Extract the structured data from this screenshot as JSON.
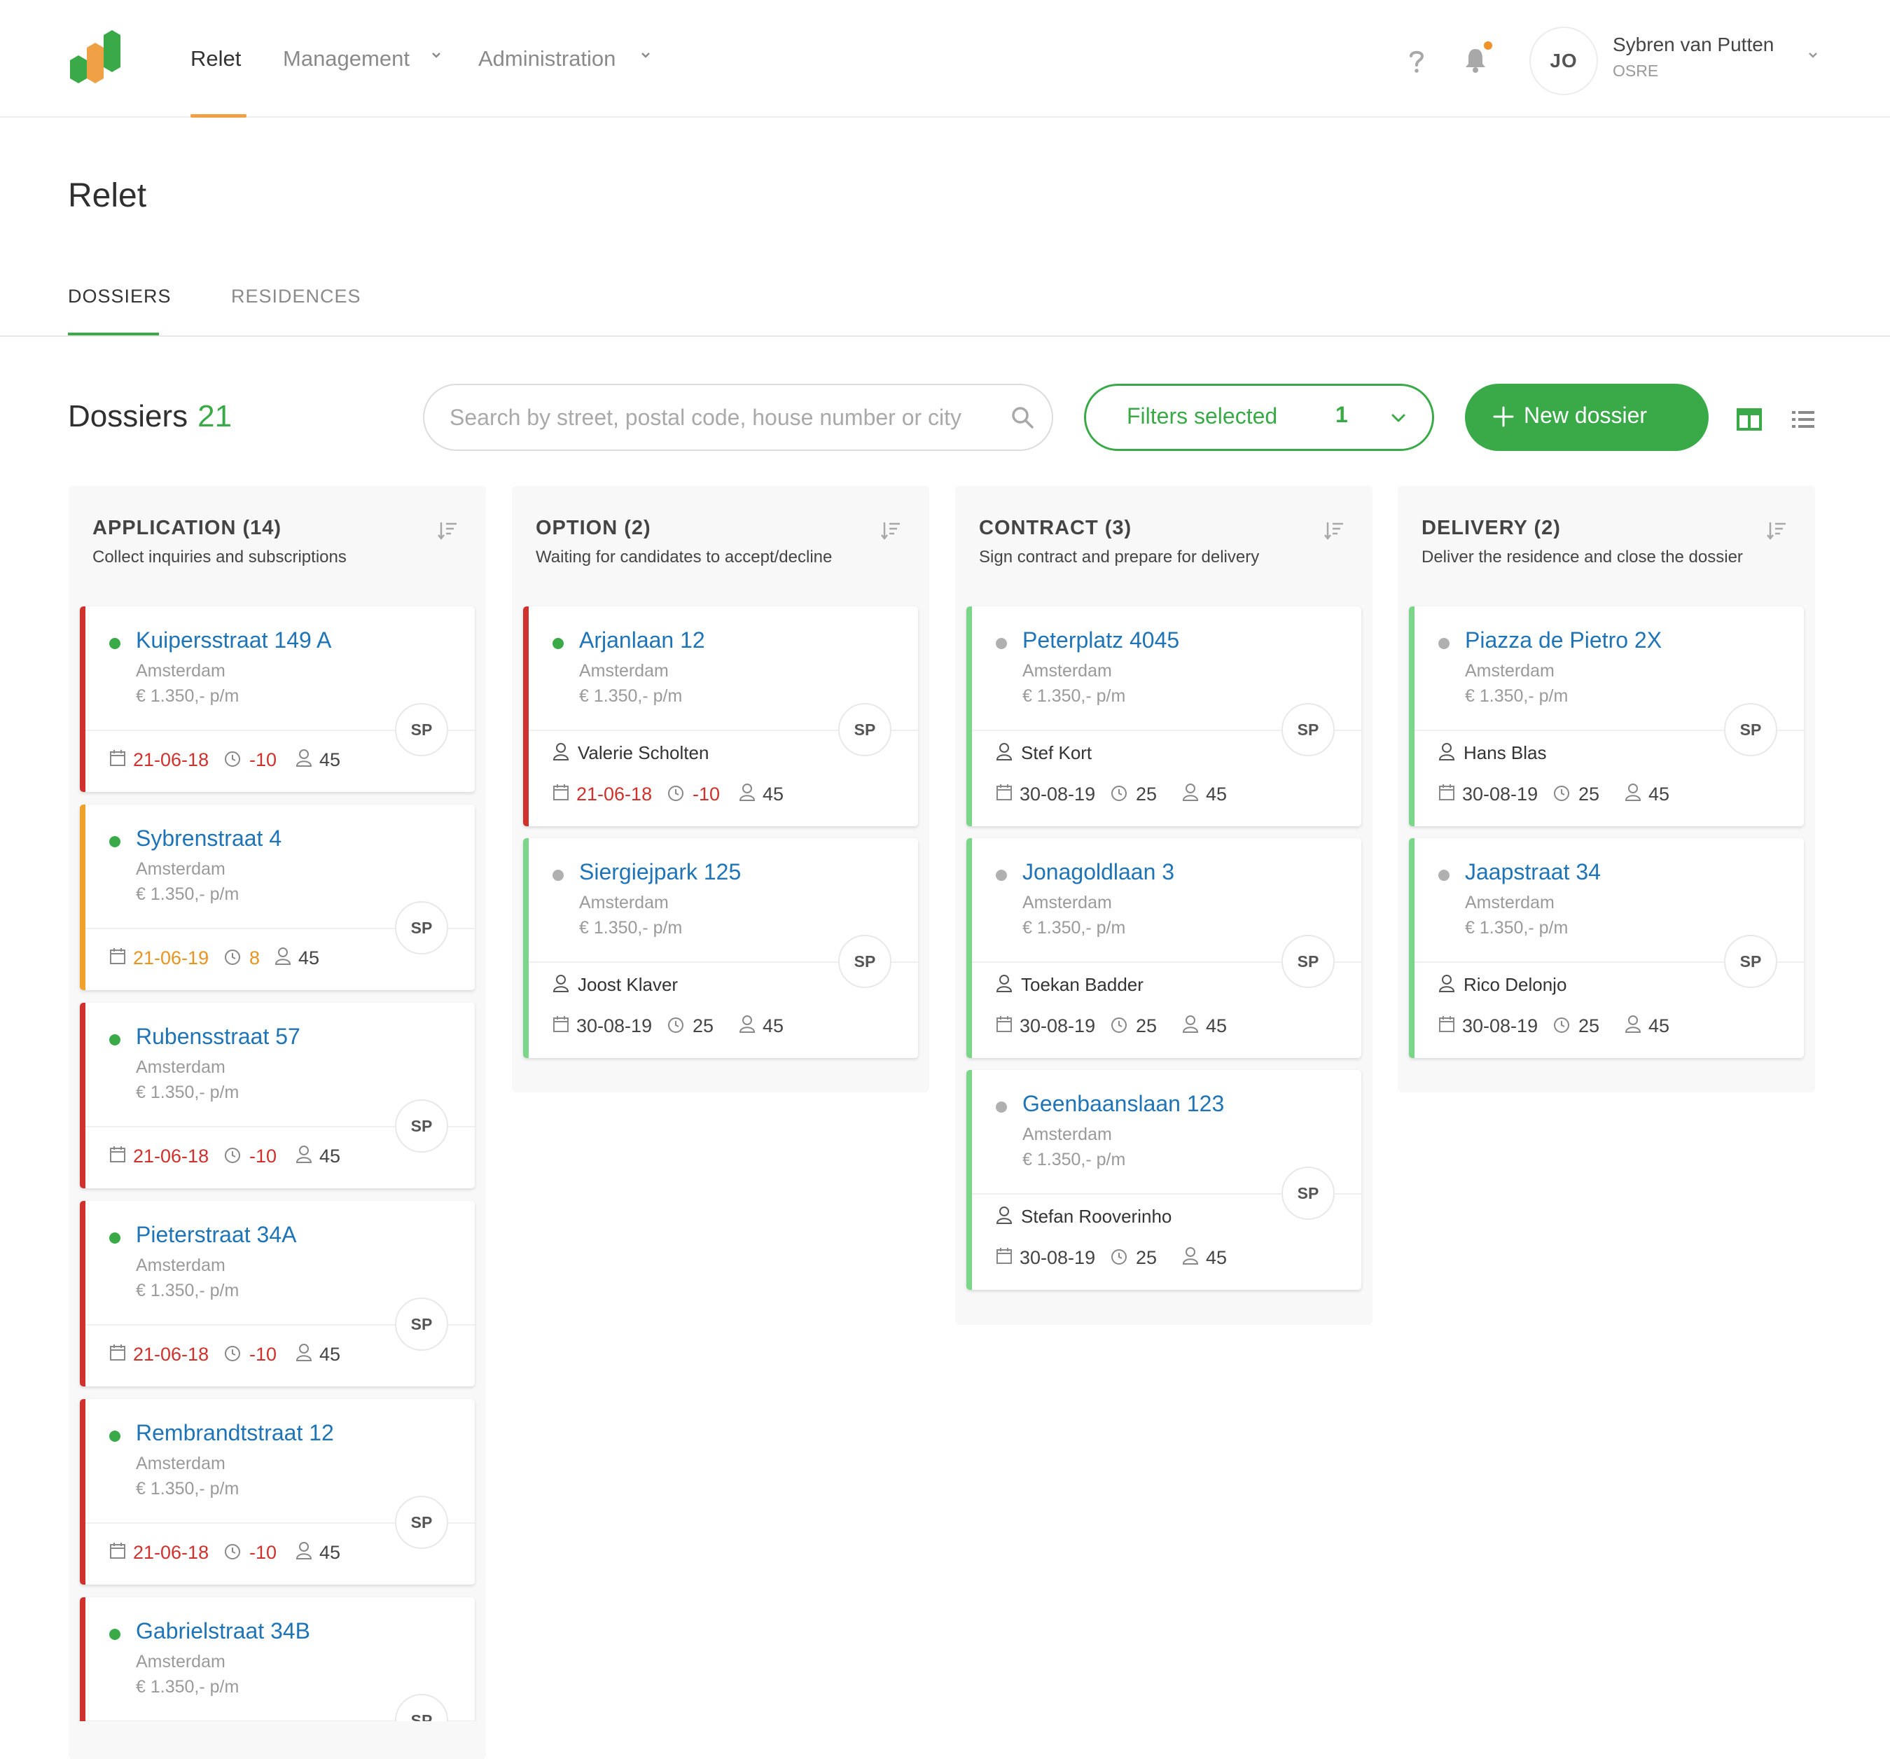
{
  "app": {
    "brand_colors": {
      "green": "#3aaa49",
      "orange": "#f0a146",
      "red": "#d0312d",
      "link_blue": "#1f74b7"
    }
  },
  "nav": {
    "items": [
      {
        "label": "Relet"
      },
      {
        "label": "Management"
      },
      {
        "label": "Administration"
      }
    ],
    "help_icon": "question-mark-icon",
    "notification_icon": "bell-icon",
    "user": {
      "initials": "JO",
      "name": "Sybren van Putten",
      "org": "OSRE"
    }
  },
  "page": {
    "title": "Relet"
  },
  "tabs": [
    {
      "label": "DOSSIERS"
    },
    {
      "label": "RESIDENCES"
    }
  ],
  "toolbar": {
    "heading": "Dossiers",
    "count": "21",
    "search_placeholder": "Search by street, postal code, house number or city",
    "search_value": "",
    "filters_label": "Filters selected",
    "filters_count": "1",
    "new_label": "New dossier",
    "view_icons": [
      "board-view-icon",
      "list-view-icon"
    ]
  },
  "columns": [
    {
      "title": "APPLICATION (14)",
      "subtitle": "Collect inquiries and subscriptions",
      "cards": [
        {
          "street": "Kuipersstraat 149 A",
          "city": "Amsterdam",
          "price": "€ 1.350,- p/m",
          "badge": "SP",
          "date": "21-06-18",
          "days": "-10",
          "people": "45"
        },
        {
          "street": "Sybrenstraat 4",
          "city": "Amsterdam",
          "price": "€ 1.350,- p/m",
          "badge": "SP",
          "date": "21-06-19",
          "days": "8",
          "people": "45"
        },
        {
          "street": "Rubensstraat 57",
          "city": "Amsterdam",
          "price": "€ 1.350,- p/m",
          "badge": "SP",
          "date": "21-06-18",
          "days": "-10",
          "people": "45"
        },
        {
          "street": "Pieterstraat 34A",
          "city": "Amsterdam",
          "price": "€ 1.350,- p/m",
          "badge": "SP",
          "date": "21-06-18",
          "days": "-10",
          "people": "45"
        },
        {
          "street": "Rembrandtstraat 12",
          "city": "Amsterdam",
          "price": "€ 1.350,- p/m",
          "badge": "SP",
          "date": "21-06-18",
          "days": "-10",
          "people": "45"
        },
        {
          "street": "Gabrielstraat 34B",
          "city": "Amsterdam",
          "price": "€ 1.350,- p/m",
          "badge": "SP"
        }
      ]
    },
    {
      "title": "OPTION (2)",
      "subtitle": "Waiting for candidates to accept/decline",
      "cards": [
        {
          "street": "Arjanlaan 12",
          "city": "Amsterdam",
          "price": "€ 1.350,- p/m",
          "badge": "SP",
          "person": "Valerie Scholten",
          "date": "21-06-18",
          "days": "-10",
          "people": "45"
        },
        {
          "street": "Siergiejpark 125",
          "city": "Amsterdam",
          "price": "€ 1.350,- p/m",
          "badge": "SP",
          "person": "Joost Klaver",
          "date": "30-08-19",
          "days": "25",
          "people": "45"
        }
      ]
    },
    {
      "title": "CONTRACT (3)",
      "subtitle": "Sign contract and prepare for delivery",
      "cards": [
        {
          "street": "Peterplatz 4045",
          "city": "Amsterdam",
          "price": "€ 1.350,- p/m",
          "badge": "SP",
          "person": "Stef Kort",
          "date": "30-08-19",
          "days": "25",
          "people": "45"
        },
        {
          "street": "Jonagoldlaan 3",
          "city": "Amsterdam",
          "price": "€ 1.350,- p/m",
          "badge": "SP",
          "person": "Toekan Badder",
          "date": "30-08-19",
          "days": "25",
          "people": "45"
        },
        {
          "street": "Geenbaanslaan 123",
          "city": "Amsterdam",
          "price": "€ 1.350,- p/m",
          "badge": "SP",
          "person": "Stefan Rooverinho",
          "date": "30-08-19",
          "days": "25",
          "people": "45"
        }
      ]
    },
    {
      "title": "DELIVERY (2)",
      "subtitle": "Deliver the residence and close the dossier",
      "cards": [
        {
          "street": "Piazza de Pietro 2X",
          "city": "Amsterdam",
          "price": "€ 1.350,- p/m",
          "badge": "SP",
          "person": "Hans Blas",
          "date": "30-08-19",
          "days": "25",
          "people": "45"
        },
        {
          "street": "Jaapstraat 34",
          "city": "Amsterdam",
          "price": "€ 1.350,- p/m",
          "badge": "SP",
          "person": "Rico Delonjo",
          "date": "30-08-19",
          "days": "25",
          "people": "45"
        }
      ]
    }
  ]
}
